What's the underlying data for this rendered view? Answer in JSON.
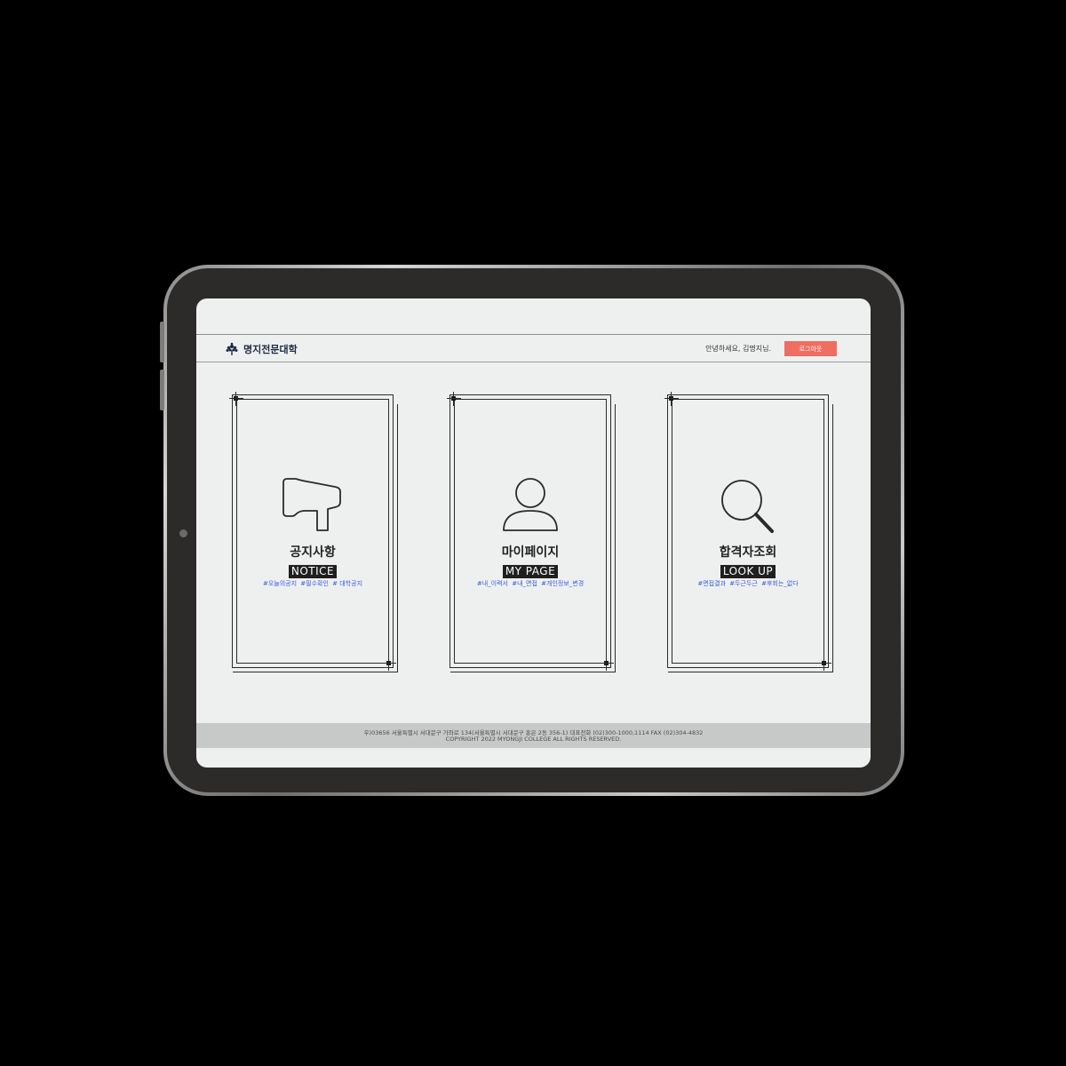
{
  "header": {
    "logo_text": "명지전문대학",
    "logo_icon": "tree-logo-icon",
    "greeting": "안녕하세요, 김명지님.",
    "logout_label": "로그아웃",
    "logout_color": "#ef6e62"
  },
  "cards": [
    {
      "icon": "megaphone-icon",
      "title": "공지사항",
      "subtitle": "NOTICE",
      "tags": [
        "#오늘의공지",
        "#필수확인",
        "# 대학공지"
      ]
    },
    {
      "icon": "user-icon",
      "title": "마이페이지",
      "subtitle": "MY PAGE",
      "tags": [
        "#내_이력서",
        "#내_면접",
        "#개인정보_변경"
      ]
    },
    {
      "icon": "search-icon",
      "title": "합격자조회",
      "subtitle": "LOOK UP",
      "tags": [
        "#면접결과",
        "#두근두근",
        "#후회는_없다"
      ]
    }
  ],
  "footer": {
    "address": "우)03656 서울특별시 서대문구 가좌로 134(서울특별시 서대문구 홍은 2동 356-1) 대표전화 (02)300-1000,1114 FAX (02)304-4832",
    "copyright": "COPYRIGHT 2022 MYONGJI COLLEGE ALL RIGHTS RESERVED."
  },
  "colors": {
    "tag": "#3b5bd9",
    "screen_bg": "#eef0f0",
    "footer_bg": "#c7c9c9"
  }
}
